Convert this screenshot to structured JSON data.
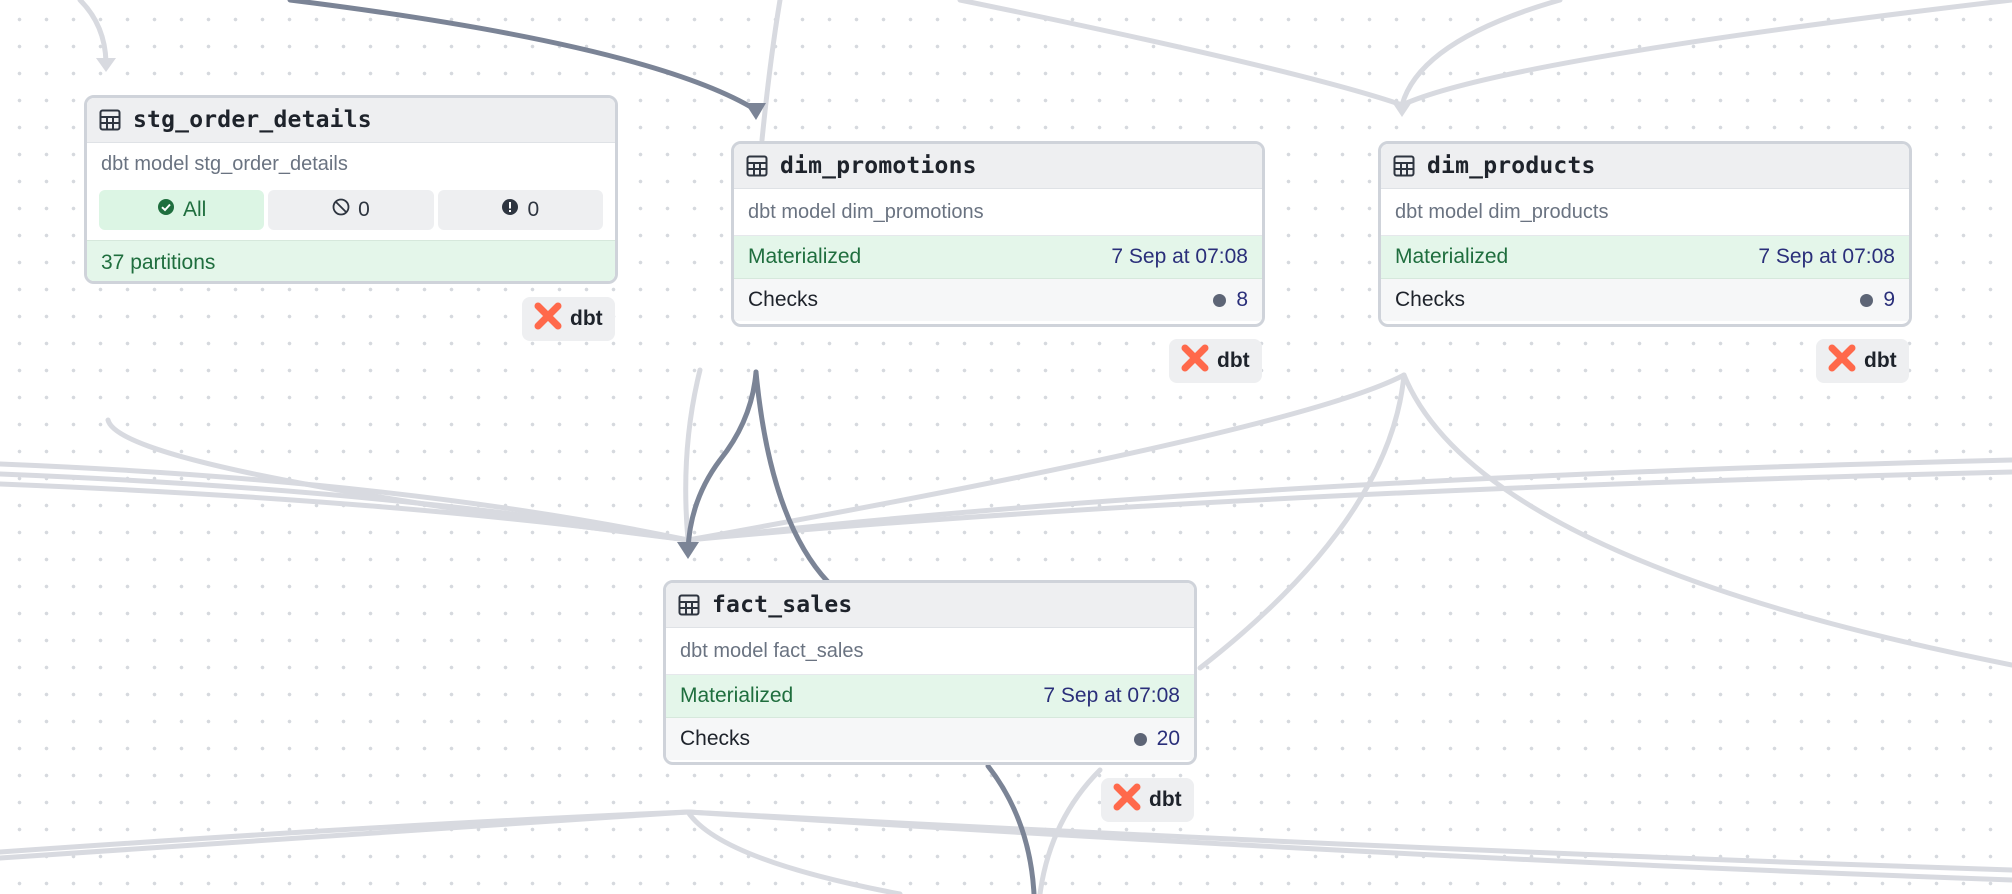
{
  "colors": {
    "edge_light": "#d8dae0",
    "edge_dark": "#7b8496",
    "materialized_bg": "#e4f6ea",
    "materialized_text": "#1f6e3e",
    "timestamp_text": "#2a2f7a",
    "dbt_brand": "#ff694b"
  },
  "nodes": {
    "stg_order_details": {
      "icon": "table-icon",
      "title": "stg_order_details",
      "description": "dbt model stg_order_details",
      "status": {
        "all_label": "All",
        "skipped_count": "0",
        "failed_count": "0"
      },
      "partitions": "37 partitions",
      "badge": "dbt"
    },
    "dim_promotions": {
      "icon": "table-icon",
      "title": "dim_promotions",
      "description": "dbt model dim_promotions",
      "materialized_label": "Materialized",
      "materialized_time": "7 Sep at 07:08",
      "checks_label": "Checks",
      "checks_count": "8",
      "badge": "dbt"
    },
    "dim_products": {
      "icon": "table-icon",
      "title": "dim_products",
      "description": "dbt model dim_products",
      "materialized_label": "Materialized",
      "materialized_time": "7 Sep at 07:08",
      "checks_label": "Checks",
      "checks_count": "9",
      "badge": "dbt"
    },
    "fact_sales": {
      "icon": "table-icon",
      "title": "fact_sales",
      "description": "dbt model fact_sales",
      "materialized_label": "Materialized",
      "materialized_time": "7 Sep at 07:08",
      "checks_label": "Checks",
      "checks_count": "20",
      "badge": "dbt"
    }
  }
}
